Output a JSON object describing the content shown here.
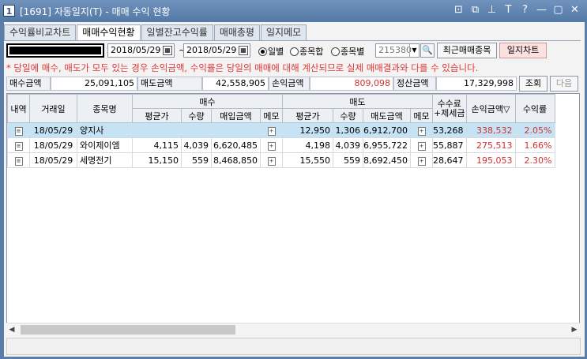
{
  "window": {
    "number": "1",
    "title": "[1691] 자동일지(T) - 매매 수익 현황",
    "icons": [
      "restore-icon",
      "copy-icon",
      "pin-icon",
      "text-icon",
      "help-icon",
      "minimize-icon",
      "maximize-icon",
      "close-icon"
    ],
    "icon_glyphs": [
      "⊡",
      "⧉",
      "⊥",
      "T",
      "?",
      "—",
      "▢",
      "✕"
    ]
  },
  "tabs": [
    {
      "label": "수익률비교차트",
      "active": false
    },
    {
      "label": "매매수익현황",
      "active": true
    },
    {
      "label": "일별잔고수익률",
      "active": false
    },
    {
      "label": "매매총평",
      "active": false
    },
    {
      "label": "일지메모",
      "active": false
    }
  ],
  "toolbar": {
    "date_from": "2018/05/29",
    "date_to": "2018/05/29",
    "tilde": "~",
    "radio_daily": "일별",
    "radio_sum": "종목합",
    "radio_by_stock": "종목별",
    "selected_radio": "일별",
    "stock_code": "215380",
    "search_glyph": "🔍",
    "recent_button": "최근매매종목",
    "chart_button": "일지차트"
  },
  "notice": "* 당일에 매수, 매도가 모두 있는 경우 손익금액, 수익률은 당일의 매매에 대해 계산되므로 실제 매매결과와 다를 수 있습니다.",
  "summary": {
    "buy_label": "매수금액",
    "buy_value": "25,091,105",
    "sell_label": "매도금액",
    "sell_value": "42,558,905",
    "pnl_label": "손익금액",
    "pnl_value": "809,098",
    "settle_label": "정산금액",
    "settle_value": "17,329,998",
    "query_button": "조회",
    "next_button": "다음"
  },
  "table": {
    "headers": {
      "detail": "내역",
      "date": "거래일",
      "name": "종목명",
      "buy": "매수",
      "sell": "매도",
      "fee_tax": "수수료\n+제세금",
      "pnl": "손익금액",
      "pnl_sort": "▽",
      "rate": "수익률",
      "buy_avg": "평균가",
      "buy_qty": "수량",
      "buy_amt": "매입금액",
      "buy_memo": "메모",
      "sell_avg": "평균가",
      "sell_qty": "수량",
      "sell_amt": "매도금액",
      "sell_memo": "메모"
    },
    "rows": [
      {
        "date": "18/05/29",
        "name": "양지사",
        "buy_avg": "",
        "buy_qty": "",
        "buy_amt": "",
        "sell_avg": "12,950",
        "sell_qty": "1,306",
        "sell_amt": "6,912,700",
        "fee": "53,268",
        "pnl": "338,532",
        "rate": "2.05%",
        "selected": true
      },
      {
        "date": "18/05/29",
        "name": "와이제이엠",
        "buy_avg": "4,115",
        "buy_qty": "4,039",
        "buy_amt": "6,620,485",
        "sell_avg": "4,198",
        "sell_qty": "4,039",
        "sell_amt": "6,955,722",
        "fee": "55,887",
        "pnl": "275,513",
        "rate": "1.66%",
        "selected": false
      },
      {
        "date": "18/05/29",
        "name": "세명전기",
        "buy_avg": "15,150",
        "buy_qty": "559",
        "buy_amt": "8,468,850",
        "sell_avg": "15,550",
        "sell_qty": "559",
        "sell_amt": "8,692,450",
        "fee": "28,647",
        "pnl": "195,053",
        "rate": "2.30%",
        "selected": false
      }
    ]
  },
  "colors": {
    "titlebar": "#5a7ea9",
    "notice": "#e03535",
    "profit": "#d03030",
    "selected_row": "#c6e3f5"
  }
}
